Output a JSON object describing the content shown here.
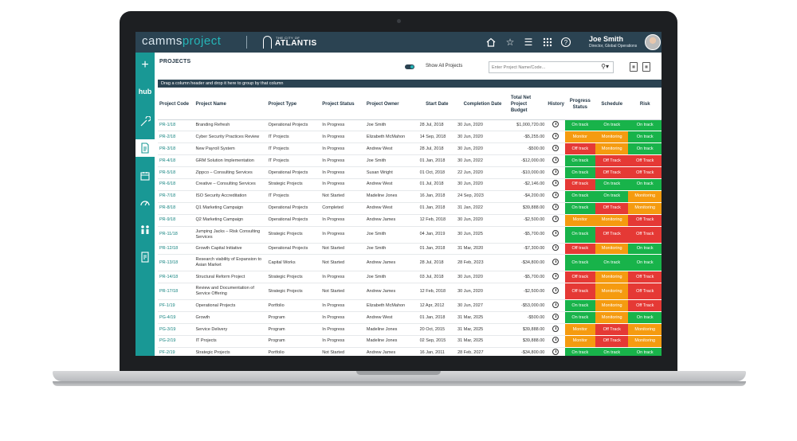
{
  "app": {
    "logo_prefix": "camms",
    "logo_suffix": "project",
    "org_small": "THE CITY OF",
    "org_name": "ATLANTIS",
    "user_name": "Joe Smith",
    "user_role": "Director, Global Operations"
  },
  "header_icons": [
    "home-icon",
    "star-icon",
    "menu-icon",
    "apps-grid-icon",
    "help-icon"
  ],
  "sidebar": {
    "items": [
      {
        "icon": "plus-icon"
      },
      {
        "icon": "hub-icon",
        "label": "hub"
      },
      {
        "icon": "tools-icon"
      },
      {
        "icon": "document-icon",
        "active": true
      },
      {
        "icon": "calendar-icon"
      },
      {
        "icon": "gauge-icon"
      },
      {
        "icon": "people-icon"
      },
      {
        "icon": "report-icon"
      }
    ]
  },
  "main": {
    "title": "PROJECTS",
    "show_all_label": "Show All Projects",
    "search_placeholder": "Enter Project Name/Code...",
    "group_hint": "Drag a column header and drop it here to group by that column"
  },
  "table": {
    "columns": [
      "Project Code",
      "Project Name",
      "Project Type",
      "Project Status",
      "Project Owner",
      "Start Date",
      "Completion Date",
      "Total Net Project Budget",
      "History",
      "Progress Status",
      "Schedule",
      "Risk"
    ],
    "rows": [
      {
        "code": "PR-1/18",
        "name": "Branding Refresh",
        "type": "Operational Projects",
        "status": "In Progress",
        "owner": "Joe Smith",
        "start": "28 Jul, 2018",
        "end": "30 Jun, 2020",
        "budget": "$1,000,720.00",
        "progress": "On track",
        "schedule": "On track",
        "risk": "On track"
      },
      {
        "code": "PR-2/18",
        "name": "Cyber Security Practices Review",
        "type": "IT Projects",
        "status": "In Progress",
        "owner": "Elizabeth McMahon",
        "start": "14 Sep, 2018",
        "end": "30 Jun, 2020",
        "budget": "-$5,255.00",
        "progress": "Monitor",
        "schedule": "Monitoring",
        "risk": "On track"
      },
      {
        "code": "PR-3/18",
        "name": "New Payroll System",
        "type": "IT Projects",
        "status": "In Progress",
        "owner": "Andrew West",
        "start": "28 Jul, 2018",
        "end": "30 Jun, 2020",
        "budget": "-$500.00",
        "progress": "Off track",
        "schedule": "Monitoring",
        "risk": "On track"
      },
      {
        "code": "PR-4/18",
        "name": "GRM Solution Implementation",
        "type": "IT Projects",
        "status": "In Progress",
        "owner": "Joe Smith",
        "start": "01 Jan, 2018",
        "end": "30 Jun, 2022",
        "budget": "-$12,000.00",
        "progress": "On track",
        "schedule": "Off Track",
        "risk": "Off Track"
      },
      {
        "code": "PR-5/18",
        "name": "Zippco – Consulting Services",
        "type": "Operational Projects",
        "status": "In Progress",
        "owner": "Susan Wright",
        "start": "01 Oct, 2018",
        "end": "22 Jun, 2020",
        "budget": "-$10,000.00",
        "progress": "On track",
        "schedule": "Off Track",
        "risk": "Off Track"
      },
      {
        "code": "PR-6/18",
        "name": "Creative – Consulting Services",
        "type": "Strategic Projects",
        "status": "In Progress",
        "owner": "Andrew West",
        "start": "01 Jul, 2018",
        "end": "30 Jun, 2020",
        "budget": "-$2,146.00",
        "progress": "Off track",
        "schedule": "On track",
        "risk": "On track"
      },
      {
        "code": "PR-7/18",
        "name": "ISO Security Accreditation",
        "type": "IT Projects",
        "status": "Not Started",
        "owner": "Madeline Jones",
        "start": "16 Jan, 2018",
        "end": "24 Sep, 2023",
        "budget": "-$4,200.00",
        "progress": "On track",
        "schedule": "On track",
        "risk": "Monitoring"
      },
      {
        "code": "PR-8/18",
        "name": "Q1 Marketing Campaign",
        "type": "Operational Projects",
        "status": "Completed",
        "owner": "Andrew West",
        "start": "01 Jan, 2018",
        "end": "31 Jan, 2022",
        "budget": "$39,888.00",
        "progress": "On track",
        "schedule": "Off Track",
        "risk": "Monitoring"
      },
      {
        "code": "PR-9/18",
        "name": "Q2 Marketing Campaign",
        "type": "Operational Projects",
        "status": "In Progress",
        "owner": "Andrew James",
        "start": "12 Feb, 2018",
        "end": "30 Jun, 2020",
        "budget": "-$2,500.00",
        "progress": "Monitor",
        "schedule": "Monitoring",
        "risk": "Off Track"
      },
      {
        "code": "PR-11/18",
        "name": "Jumping Jacks – Risk Consulting Services",
        "type": "Strategic Projects",
        "status": "In Progress",
        "owner": "Joe Smith",
        "start": "04 Jan, 2019",
        "end": "30 Jun, 2025",
        "budget": "-$5,700.00",
        "progress": "On track",
        "schedule": "Off Track",
        "risk": "Off Track"
      },
      {
        "code": "PR-12/18",
        "name": "Growth Capital Initiative",
        "type": "Operational Projects",
        "status": "Not Started",
        "owner": "Joe Smith",
        "start": "01 Jan, 2018",
        "end": "31 Mar, 2020",
        "budget": "-$7,300.00",
        "progress": "Off track",
        "schedule": "Monitoring",
        "risk": "On track"
      },
      {
        "code": "PR-13/18",
        "name": "Research viability of Expansion to Asian Market",
        "type": "Capital Works",
        "status": "Not Started",
        "owner": "Andrew James",
        "start": "28 Jul, 2018",
        "end": "28 Feb, 2023",
        "budget": "-$34,800.00",
        "progress": "On track",
        "schedule": "On track",
        "risk": "On track"
      },
      {
        "code": "PR-14/18",
        "name": "Structural Reform Project",
        "type": "Strategic Projects",
        "status": "In Progress",
        "owner": "Joe Smith",
        "start": "03 Jul, 2018",
        "end": "30 Jun, 2020",
        "budget": "-$5,700.00",
        "progress": "Off track",
        "schedule": "Monitoring",
        "risk": "Off Track"
      },
      {
        "code": "PR-17/18",
        "name": "Review and Documentation of Service Offering",
        "type": "Strategic Projects",
        "status": "Not Started",
        "owner": "Andrew James",
        "start": "12 Feb, 2018",
        "end": "30 Jun, 2020",
        "budget": "-$2,500.00",
        "progress": "Off track",
        "schedule": "Monitoring",
        "risk": "Off Track"
      },
      {
        "code": "PF-1/19",
        "name": "Operational Projects",
        "type": "Portfolio",
        "status": "In Progress",
        "owner": "Elizabeth McMahon",
        "start": "12 Apr, 2012",
        "end": "30 Jun, 2027",
        "budget": "-$53,000.00",
        "progress": "On track",
        "schedule": "Monitoring",
        "risk": "Off Track"
      },
      {
        "code": "PG-4/19",
        "name": "Growth",
        "type": "Program",
        "status": "In Progress",
        "owner": "Andrew West",
        "start": "01 Jan, 2018",
        "end": "31 Mar, 2025",
        "budget": "-$500.00",
        "progress": "On track",
        "schedule": "Monitoring",
        "risk": "On track"
      },
      {
        "code": "PG-3/19",
        "name": "Service Delivery",
        "type": "Program",
        "status": "In Progress",
        "owner": "Madeline Jones",
        "start": "20 Oct, 2015",
        "end": "31 Mar, 2025",
        "budget": "$39,888.00",
        "progress": "Monitor",
        "schedule": "Off Track",
        "risk": "Monitoring"
      },
      {
        "code": "PG-2/19",
        "name": "IT Projects",
        "type": "Program",
        "status": "In Progress",
        "owner": "Madeline Jones",
        "start": "02 Sep, 2015",
        "end": "31 Mar, 2025",
        "budget": "$39,888.00",
        "progress": "Monitor",
        "schedule": "Off Track",
        "risk": "Monitoring"
      },
      {
        "code": "PF-2/19",
        "name": "Strategic Projects",
        "type": "Portfolio",
        "status": "Not Started",
        "owner": "Andrew James",
        "start": "16 Jan, 2011",
        "end": "28 Feb, 2027",
        "budget": "-$34,800.00",
        "progress": "On track",
        "schedule": "On track",
        "risk": "On track"
      }
    ]
  },
  "colors": {
    "header": "#2b4352",
    "sidebar": "#199895",
    "on_track": "#18b34a",
    "monitor": "#f59b10",
    "off_track": "#e53935"
  }
}
